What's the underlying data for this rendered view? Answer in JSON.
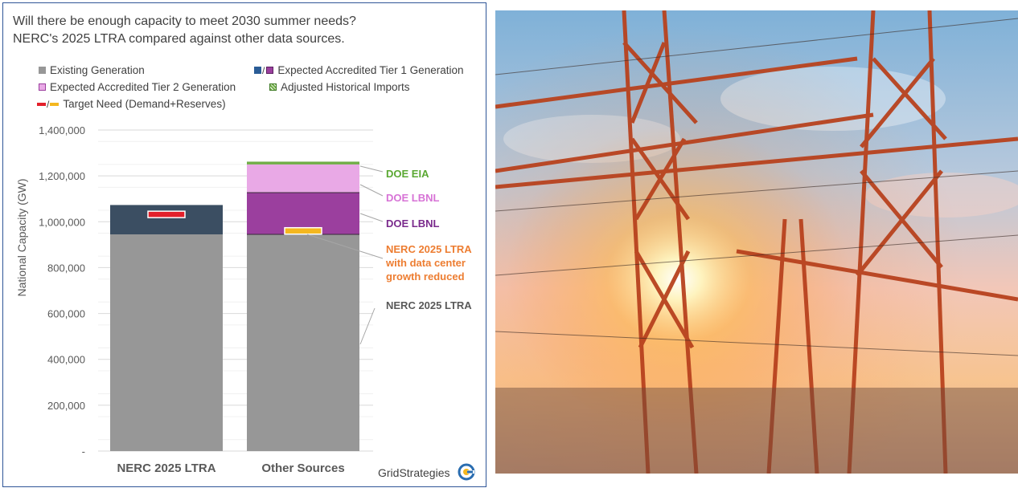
{
  "title_lines": [
    "Will there be enough capacity to meet 2030 summer needs?",
    "NERC's 2025 LTRA compared against other data sources."
  ],
  "legend": {
    "existing": "Existing Generation",
    "tier1": "Expected Accredited Tier 1 Generation",
    "tier2": "Expected Accredited Tier 2 Generation",
    "imports": "Adjusted Historical Imports",
    "target": "Target Need (Demand+Reserves)"
  },
  "brand": "GridStrategies",
  "colors": {
    "existing": "#979797",
    "nerc_tier1": "#3b4e62",
    "other_tier1": "#9b3f9e",
    "tier2": "#e9a9e6",
    "imports": "#70ad47",
    "target_red": "#e3202b",
    "target_yellow": "#f4b71f",
    "label_green": "#5aa832",
    "label_pink": "#d773d6",
    "label_purple": "#7a2a8c",
    "label_orange": "#ed7d31",
    "label_gray": "#595959",
    "title": "#404040",
    "frame": "#2f5597"
  },
  "chart_data": {
    "type": "bar",
    "stacked": true,
    "categories": [
      "NERC 2025 LTRA",
      "Other Sources"
    ],
    "ylabel": "National Capacity (GW)",
    "ylim": [
      0,
      1400000
    ],
    "yticks": [
      0,
      200000,
      400000,
      600000,
      800000,
      1000000,
      1200000,
      1400000
    ],
    "ytick_labels": [
      "-",
      "200,000",
      "400,000",
      "600,000",
      "800,000",
      "1,000,000",
      "1,200,000",
      "1,400,000"
    ],
    "grid": true,
    "legend_position": "top",
    "series": [
      {
        "name": "Existing Generation",
        "values": [
          945000,
          945000
        ]
      },
      {
        "name": "Expected Accredited Tier 1 Generation",
        "values": [
          128000,
          182000
        ]
      },
      {
        "name": "Expected Accredited Tier 2 Generation",
        "values": [
          0,
          123000
        ]
      },
      {
        "name": "Adjusted Historical Imports",
        "values": [
          0,
          12000
        ]
      }
    ],
    "target_need": [
      1032000,
      960000
    ],
    "annotations": [
      {
        "text": "DOE EIA",
        "color_key": "label_green",
        "points_to": 1256000
      },
      {
        "text": "DOE LBNL",
        "color_key": "label_pink",
        "points_to": 1190000
      },
      {
        "text": "DOE LBNL",
        "color_key": "label_purple",
        "points_to": 1030000
      },
      {
        "text": "NERC 2025 LTRA\nwith data center\ngrowth reduced",
        "color_key": "label_orange",
        "points_to": 960000
      },
      {
        "text": "NERC 2025 LTRA",
        "color_key": "label_gray",
        "points_to": 470000
      }
    ]
  }
}
